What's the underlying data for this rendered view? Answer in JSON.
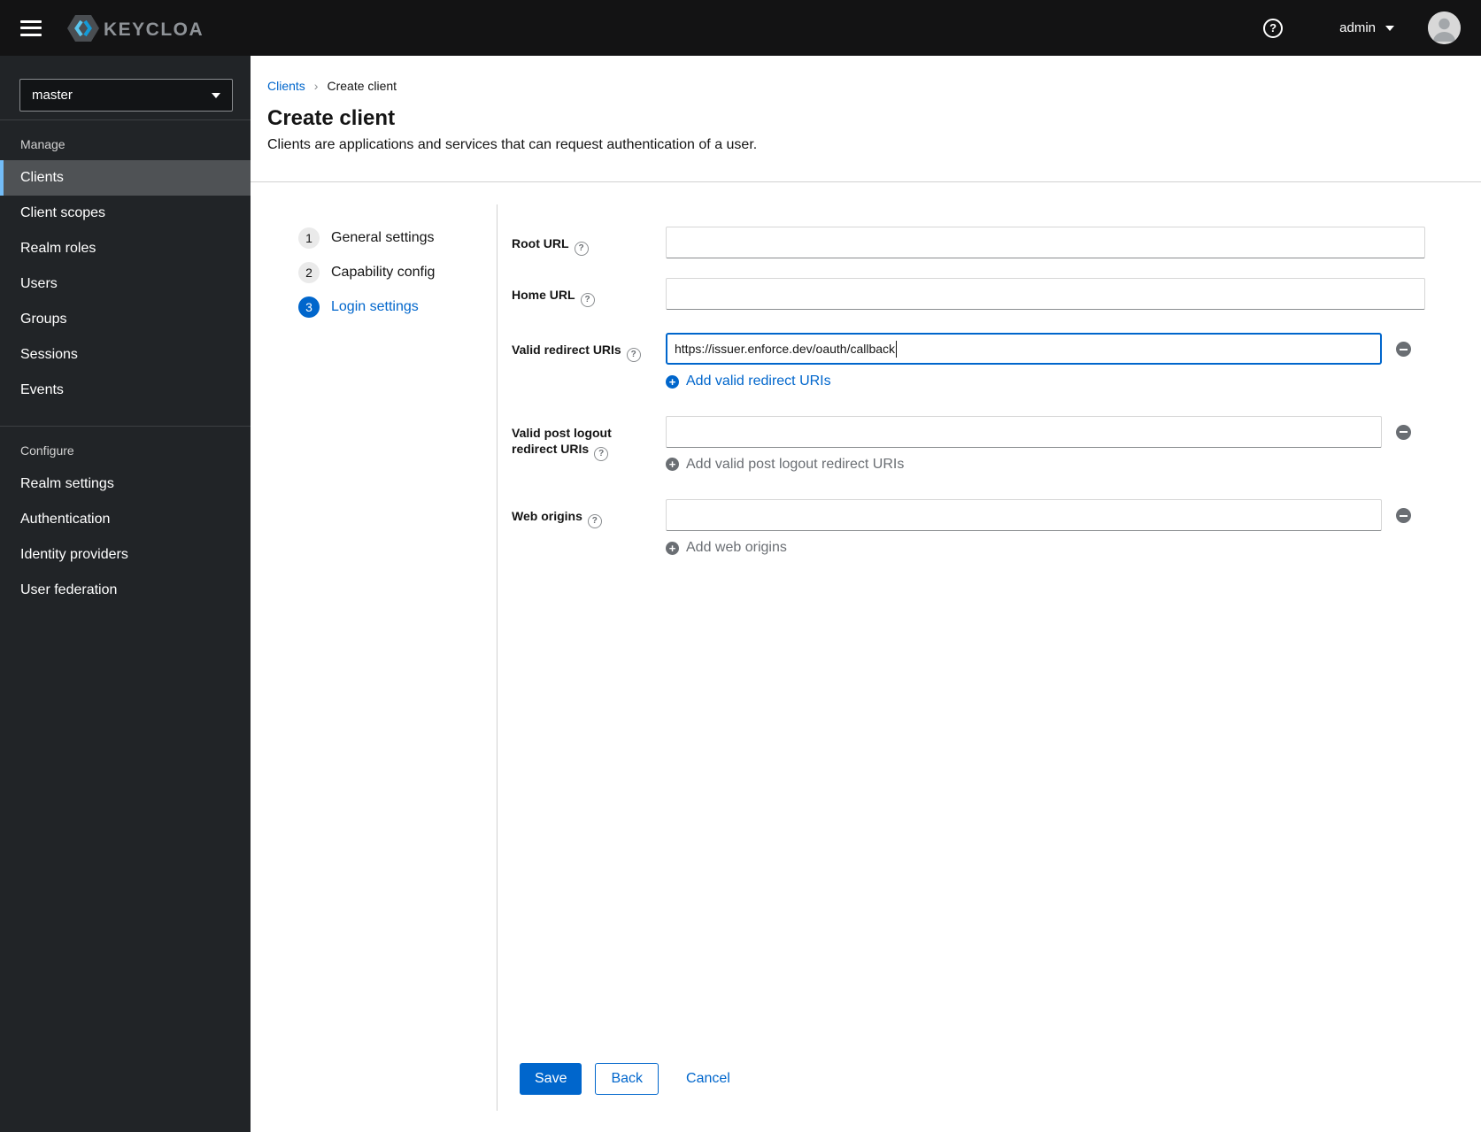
{
  "masthead": {
    "brand_text": "KEYCLOAK",
    "help_icon": "question-circle-icon",
    "username": "admin"
  },
  "sidebar": {
    "realm": "master",
    "manage_label": "Manage",
    "manage_items": [
      "Clients",
      "Client scopes",
      "Realm roles",
      "Users",
      "Groups",
      "Sessions",
      "Events"
    ],
    "active_item": "Clients",
    "configure_label": "Configure",
    "configure_items": [
      "Realm settings",
      "Authentication",
      "Identity providers",
      "User federation"
    ]
  },
  "breadcrumb": {
    "parent": "Clients",
    "current": "Create client"
  },
  "header": {
    "title": "Create client",
    "subtitle": "Clients are applications and services that can request authentication of a user."
  },
  "wizard": {
    "active_step": "3",
    "steps": [
      {
        "number": "1",
        "label": "General settings"
      },
      {
        "number": "2",
        "label": "Capability config"
      },
      {
        "number": "3",
        "label": "Login settings"
      }
    ]
  },
  "form": {
    "root_url": {
      "label": "Root URL",
      "value": ""
    },
    "home_url": {
      "label": "Home URL",
      "value": ""
    },
    "valid_redirect_uris": {
      "label": "Valid redirect URIs",
      "value": "https://issuer.enforce.dev/oauth/callback",
      "add_label": "Add valid redirect URIs"
    },
    "post_logout_uris": {
      "label_line1": "Valid post logout",
      "label_line2": "redirect URIs",
      "value": "",
      "add_label": "Add valid post logout redirect URIs"
    },
    "web_origins": {
      "label": "Web origins",
      "value": "",
      "add_label": "Add web origins"
    }
  },
  "actions": {
    "save": "Save",
    "back": "Back",
    "cancel": "Cancel"
  },
  "colors": {
    "primary": "#0066cc",
    "masthead_bg": "#131314",
    "sidebar_bg": "#212427",
    "active_nav_bg": "#4f5255",
    "nav_accent": "#73bcf7",
    "disabled_text": "#6a6e73"
  }
}
